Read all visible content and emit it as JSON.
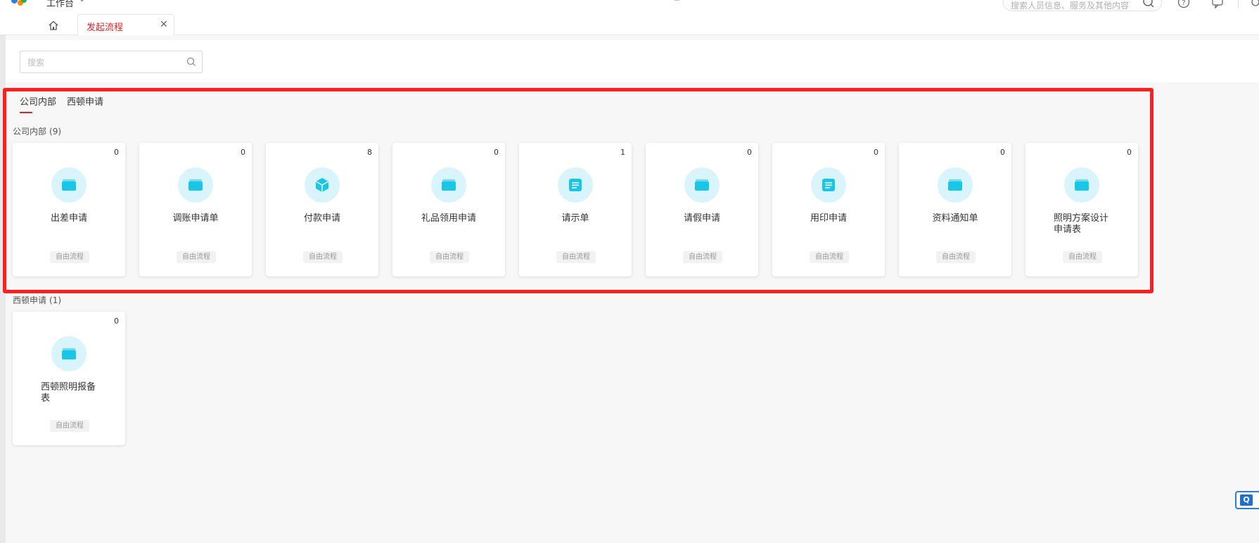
{
  "header": {
    "app_name": "工作台",
    "search_placeholder": "搜索人员信息、服务及其他内容"
  },
  "tabs": {
    "active_tab_label": "发起流程"
  },
  "search": {
    "placeholder": "搜索"
  },
  "category_tabs": [
    "公司内部",
    "西顿申请"
  ],
  "groups": [
    {
      "title": "公司内部",
      "count": "(9)",
      "items": [
        {
          "name": "出差申请",
          "count": "0",
          "badge": "自由流程",
          "icon": "folder-icon"
        },
        {
          "name": "调账申请单",
          "count": "0",
          "badge": "自由流程",
          "icon": "folder-icon"
        },
        {
          "name": "付款申请",
          "count": "8",
          "badge": "自由流程",
          "icon": "cube-icon"
        },
        {
          "name": "礼品领用申请",
          "count": "0",
          "badge": "自由流程",
          "icon": "folder-icon"
        },
        {
          "name": "请示单",
          "count": "1",
          "badge": "自由流程",
          "icon": "document-icon"
        },
        {
          "name": "请假申请",
          "count": "0",
          "badge": "自由流程",
          "icon": "folder-icon"
        },
        {
          "name": "用印申请",
          "count": "0",
          "badge": "自由流程",
          "icon": "document-icon"
        },
        {
          "name": "资料通知单",
          "count": "0",
          "badge": "自由流程",
          "icon": "folder-icon"
        },
        {
          "name": "照明方案设计申请表",
          "count": "0",
          "badge": "自由流程",
          "icon": "folder-icon"
        }
      ]
    },
    {
      "title": "西顿申请",
      "count": "(1)",
      "items": [
        {
          "name": "西顿照明报备表",
          "count": "0",
          "badge": "自由流程",
          "icon": "folder-icon"
        }
      ]
    }
  ],
  "colors": {
    "accent": "#e02424",
    "icon": "#1ac6e6",
    "icon_bg": "#d9f4fa",
    "highlight": "#ff1f1f"
  }
}
